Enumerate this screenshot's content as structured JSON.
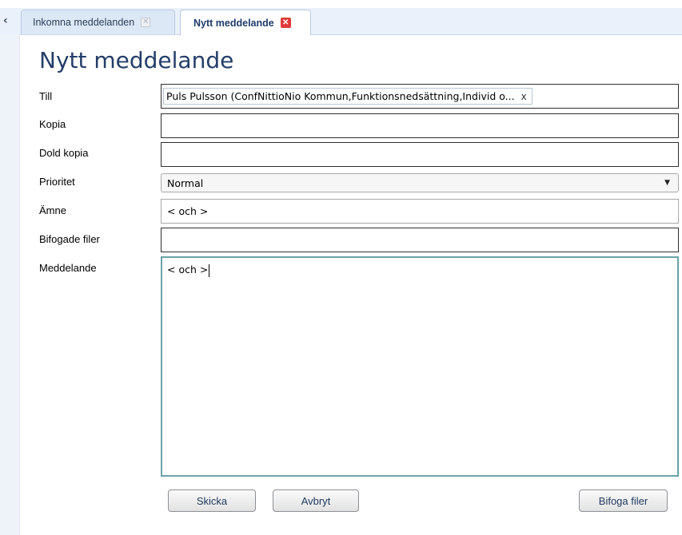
{
  "tabs": [
    {
      "label": "Inkomna meddelanden",
      "active": false
    },
    {
      "label": "Nytt meddelande",
      "active": true
    }
  ],
  "page_title": "Nytt meddelande",
  "form": {
    "to_label": "Till",
    "cc_label": "Kopia",
    "bcc_label": "Dold kopia",
    "priority_label": "Prioritet",
    "subject_label": "Ämne",
    "attachments_label": "Bifogade filer",
    "message_label": "Meddelande",
    "recipient_chip": "Puls Pulsson (ConfNittioNio Kommun,Funktionsnedsättning,Individ o...",
    "recipient_remove": "x",
    "cc_value": "",
    "bcc_value": "",
    "priority_value": "Normal",
    "subject_value": "< och >",
    "attachments_value": "",
    "message_value": "< och >"
  },
  "buttons": {
    "send": "Skicka",
    "cancel": "Avbryt",
    "attach": "Bifoga filer"
  },
  "colors": {
    "title": "#243e69",
    "tab_close_active": "#e03a3a",
    "message_focus_border": "#6aa3a8"
  }
}
